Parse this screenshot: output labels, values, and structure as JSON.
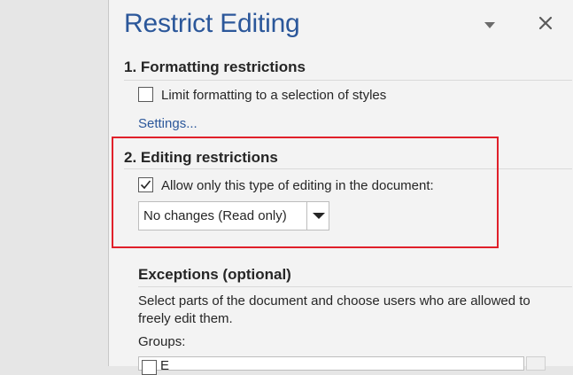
{
  "pane": {
    "title": "Restrict Editing"
  },
  "formatting": {
    "heading": "1. Formatting restrictions",
    "checkbox_label": "Limit formatting to a selection of styles",
    "checkbox_checked": false,
    "settings_link": "Settings..."
  },
  "editing": {
    "heading": "2. Editing restrictions",
    "checkbox_label": "Allow only this type of editing in the document:",
    "checkbox_checked": true,
    "select_value": "No changes (Read only)"
  },
  "exceptions": {
    "heading": "Exceptions (optional)",
    "description_line1": "Select parts of the document and choose users who are allowed to",
    "description_line2": "freely edit them.",
    "groups_label": "Groups:",
    "groups_first_item": "E"
  },
  "colors": {
    "accent_blue": "#2b579a",
    "highlight_red": "#e0202a",
    "pane_background": "#f3f3f3"
  }
}
